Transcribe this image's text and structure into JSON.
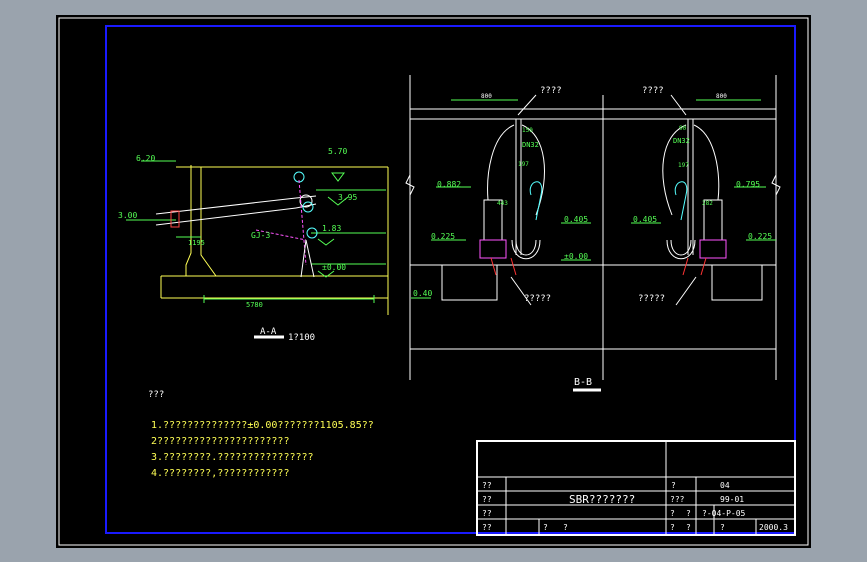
{
  "section_aa": {
    "elev_620": "6.20",
    "elev_570": "5.70",
    "elev_300": "3.00",
    "elev_395": "3.95",
    "elev_183": "1.83",
    "elev_000": "±0.00",
    "gj": "GJ-3",
    "dim_1195": "1195",
    "dim_5780": "5780",
    "title": "A-A",
    "scale": "1?100"
  },
  "section_bb": {
    "dim_800_left": "800",
    "dim_800_right": "800",
    "label_top_left": "????",
    "label_top_right": "????",
    "dn_left": "DN32",
    "dn_right": "DN32",
    "dim_150": "150",
    "dim_90": "90",
    "dim_197_left": "197",
    "dim_197_right": "197",
    "dim_443": "443",
    "dim_282": "282",
    "elev_0882": "0.882",
    "elev_0405_left": "0.405",
    "elev_0225_left": "0.225",
    "elev_000": "±0.00",
    "elev_0405_right": "0.405",
    "elev_0795": "0.795",
    "elev_0225_right": "0.225",
    "elev_040": "0.40",
    "label_bottom_left": "?????",
    "label_bottom_right": "?????",
    "title": "B-B"
  },
  "notes": {
    "heading": "???",
    "items": [
      "1.??????????????±0.00???????1105.85??",
      "2??????????????????????",
      "3.????????.????????????????",
      "4.????????,????????????"
    ]
  },
  "title_block": {
    "r1c1": "??",
    "r2c1": "??",
    "r3c1": "??",
    "r4c1": "??",
    "drawing_name": "SBR???????",
    "bottom_mid1": "?",
    "bottom_mid2": "?",
    "r1_label": "?",
    "r1_value": "04",
    "r2_label": "???",
    "r2_value": "99-01",
    "r3_label1": "?",
    "r3_label2": "?",
    "r3_value": "?-04-P-05",
    "r4_label1": "?",
    "r4_label2": "?",
    "r4_label3": "?",
    "r4_value": "2000.3"
  }
}
